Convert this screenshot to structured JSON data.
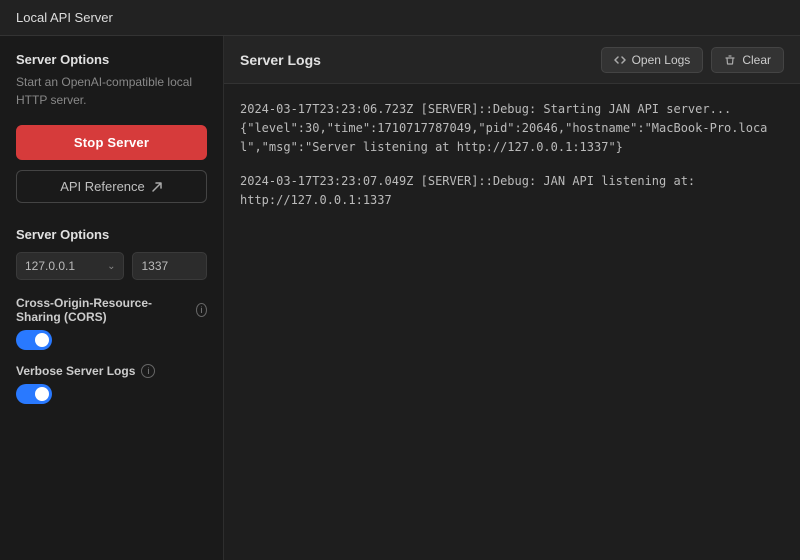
{
  "titleBar": {
    "label": "Local API Server"
  },
  "sidebar": {
    "serverOptionsTitle": "Server Options",
    "serverOptionsDescription": "Start an OpenAI-compatible local HTTP server.",
    "stopServerButton": "Stop Server",
    "apiReferenceButton": "API Reference",
    "serverOptionsSubTitle": "Server Options",
    "hostValue": "127.0.0.1",
    "portValue": "1337",
    "cors": {
      "label": "Cross-Origin-Resource-Sharing (CORS)",
      "enabled": true
    },
    "verboseLogs": {
      "label": "Verbose Server Logs",
      "enabled": true
    }
  },
  "logsPanel": {
    "title": "Server Logs",
    "openLogsButton": "Open Logs",
    "clearButton": "Clear",
    "entries": [
      {
        "text": "2024-03-17T23:23:06.723Z [SERVER]::Debug: Starting JAN API server...\n{\"level\":30,\"time\":1710717787049,\"pid\":20646,\"hostname\":\"MacBook-Pro.local\",\"msg\":\"Server listening at http://127.0.0.1:1337\"}"
      },
      {
        "text": "2024-03-17T23:23:07.049Z [SERVER]::Debug: JAN API listening at:\nhttp://127.0.0.1:1337"
      }
    ]
  },
  "icons": {
    "code": "<>",
    "clear": "✦",
    "external": "↗",
    "info": "i",
    "chevron": "⌃"
  }
}
